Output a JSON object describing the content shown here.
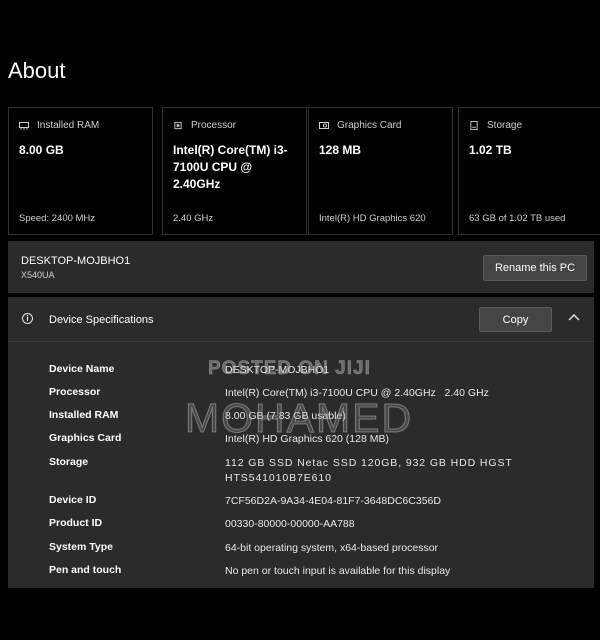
{
  "page": {
    "title": "About"
  },
  "cards": [
    {
      "label": "Installed RAM",
      "value": "8.00 GB",
      "footer": "Speed: 2400 MHz",
      "icon": "ram-icon"
    },
    {
      "label": "Processor",
      "value": "Intel(R) Core(TM) i3-7100U CPU @ 2.40GHz",
      "footer": "2.40 GHz",
      "icon": "processor-icon"
    },
    {
      "label": "Graphics Card",
      "value": "128 MB",
      "footer": "Intel(R) HD Graphics 620",
      "icon": "graphics-card-icon"
    },
    {
      "label": "Storage",
      "value": "1.02 TB",
      "footer": "63 GB of 1.02 TB used",
      "icon": "storage-icon"
    }
  ],
  "device": {
    "name": "DESKTOP-MOJBHO1",
    "model": "X540UA",
    "rename_label": "Rename this PC"
  },
  "specs": {
    "title": "Device Specifications",
    "copy_label": "Copy",
    "rows": [
      {
        "label": "Device Name",
        "value": "DESKTOP-MOJBHO1"
      },
      {
        "label": "Processor",
        "value": "Intel(R) Core(TM) i3-7100U CPU @ 2.40GHz   2.40 GHz"
      },
      {
        "label": "Installed RAM",
        "value": "8.00 GB (7.83 GB usable)"
      },
      {
        "label": "Graphics Card",
        "value": "Intel(R) HD Graphics 620 (128 MB)"
      },
      {
        "label": "Storage",
        "value": "112 GB SSD Netac SSD 120GB, 932 GB HDD HGST HTS541010B7E610"
      },
      {
        "label": "Device ID",
        "value": "7CF56D2A-9A34-4E04-81F7-3648DC6C356D"
      },
      {
        "label": "Product ID",
        "value": "00330-80000-00000-AA788"
      },
      {
        "label": "System Type",
        "value": "64-bit operating system, x64-based processor"
      },
      {
        "label": "Pen and touch",
        "value": "No pen or touch input is available for this display"
      }
    ]
  },
  "watermark": {
    "line1": "POSTED ON JIJI",
    "line2": "MOHAMED"
  }
}
